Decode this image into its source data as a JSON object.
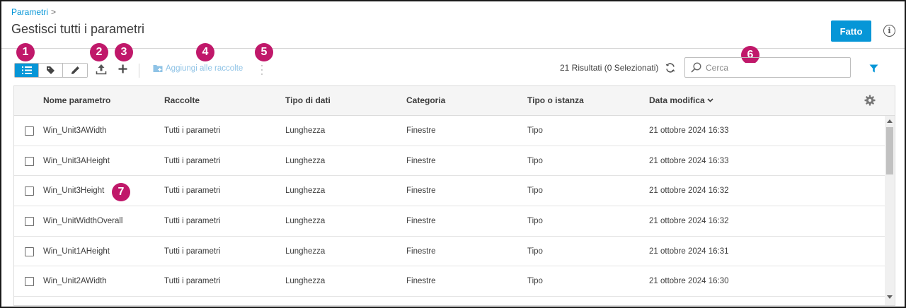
{
  "breadcrumb": {
    "link": "Parametri",
    "separator": ">"
  },
  "page_title": "Gestisci tutti i parametri",
  "done_button": "Fatto",
  "info_icon": "i",
  "badges": [
    "1",
    "2",
    "3",
    "4",
    "5",
    "6",
    "7"
  ],
  "toolbar": {
    "view_modes": [
      "list-icon",
      "tag-icon",
      "pencil-icon"
    ],
    "export_icon": "export-icon",
    "add_icon": "plus-icon",
    "add_to_collections": "Aggiungi alle raccolte",
    "more_icon": "more-vertical-icon"
  },
  "results_text": "21 Risultati (0 Selezionati)",
  "search": {
    "placeholder": "Cerca",
    "value": ""
  },
  "table": {
    "columns": [
      "Nome parametro",
      "Raccolte",
      "Tipo di dati",
      "Categoria",
      "Tipo o istanza",
      "Data modifica"
    ],
    "sort_indicator": "chevron-down-icon",
    "rows": [
      [
        "Win_Unit3AWidth",
        "Tutti i parametri",
        "Lunghezza",
        "Finestre",
        "Tipo",
        "21 ottobre 2024 16:33"
      ],
      [
        "Win_Unit3AHeight",
        "Tutti i parametri",
        "Lunghezza",
        "Finestre",
        "Tipo",
        "21 ottobre 2024 16:33"
      ],
      [
        "Win_Unit3Height",
        "Tutti i parametri",
        "Lunghezza",
        "Finestre",
        "Tipo",
        "21 ottobre 2024 16:32"
      ],
      [
        "Win_UnitWidthOverall",
        "Tutti i parametri",
        "Lunghezza",
        "Finestre",
        "Tipo",
        "21 ottobre 2024 16:32"
      ],
      [
        "Win_Unit1AHeight",
        "Tutti i parametri",
        "Lunghezza",
        "Finestre",
        "Tipo",
        "21 ottobre 2024 16:31"
      ],
      [
        "Win_Unit2AWidth",
        "Tutti i parametri",
        "Lunghezza",
        "Finestre",
        "Tipo",
        "21 ottobre 2024 16:30"
      ]
    ]
  },
  "colors": {
    "accent": "#0696d7",
    "badge": "#c0186a",
    "disabled_link": "#8fc3e6"
  }
}
